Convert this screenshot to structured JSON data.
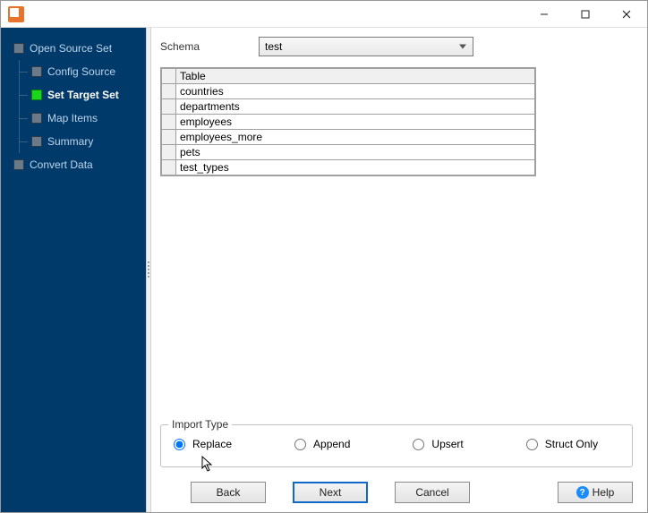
{
  "titlebar": {
    "min_tooltip": "Minimize",
    "max_tooltip": "Maximize",
    "close_tooltip": "Close"
  },
  "sidebar": {
    "items": [
      {
        "label": "Open Source Set",
        "active": false,
        "child": false
      },
      {
        "label": "Config Source",
        "active": false,
        "child": true
      },
      {
        "label": "Set Target Set",
        "active": true,
        "child": true
      },
      {
        "label": "Map Items",
        "active": false,
        "child": true
      },
      {
        "label": "Summary",
        "active": false,
        "child": true
      },
      {
        "label": "Convert Data",
        "active": false,
        "child": false
      }
    ]
  },
  "schema": {
    "label": "Schema",
    "value": "test"
  },
  "table": {
    "header": "Table",
    "rows": [
      "countries",
      "departments",
      "employees",
      "employees_more",
      "pets",
      "test_types"
    ]
  },
  "import": {
    "legend": "Import Type",
    "options": [
      {
        "label": "Replace",
        "checked": true
      },
      {
        "label": "Append",
        "checked": false
      },
      {
        "label": "Upsert",
        "checked": false
      },
      {
        "label": "Struct Only",
        "checked": false
      }
    ]
  },
  "buttons": {
    "back": "Back",
    "next": "Next",
    "cancel": "Cancel",
    "help": "Help"
  }
}
